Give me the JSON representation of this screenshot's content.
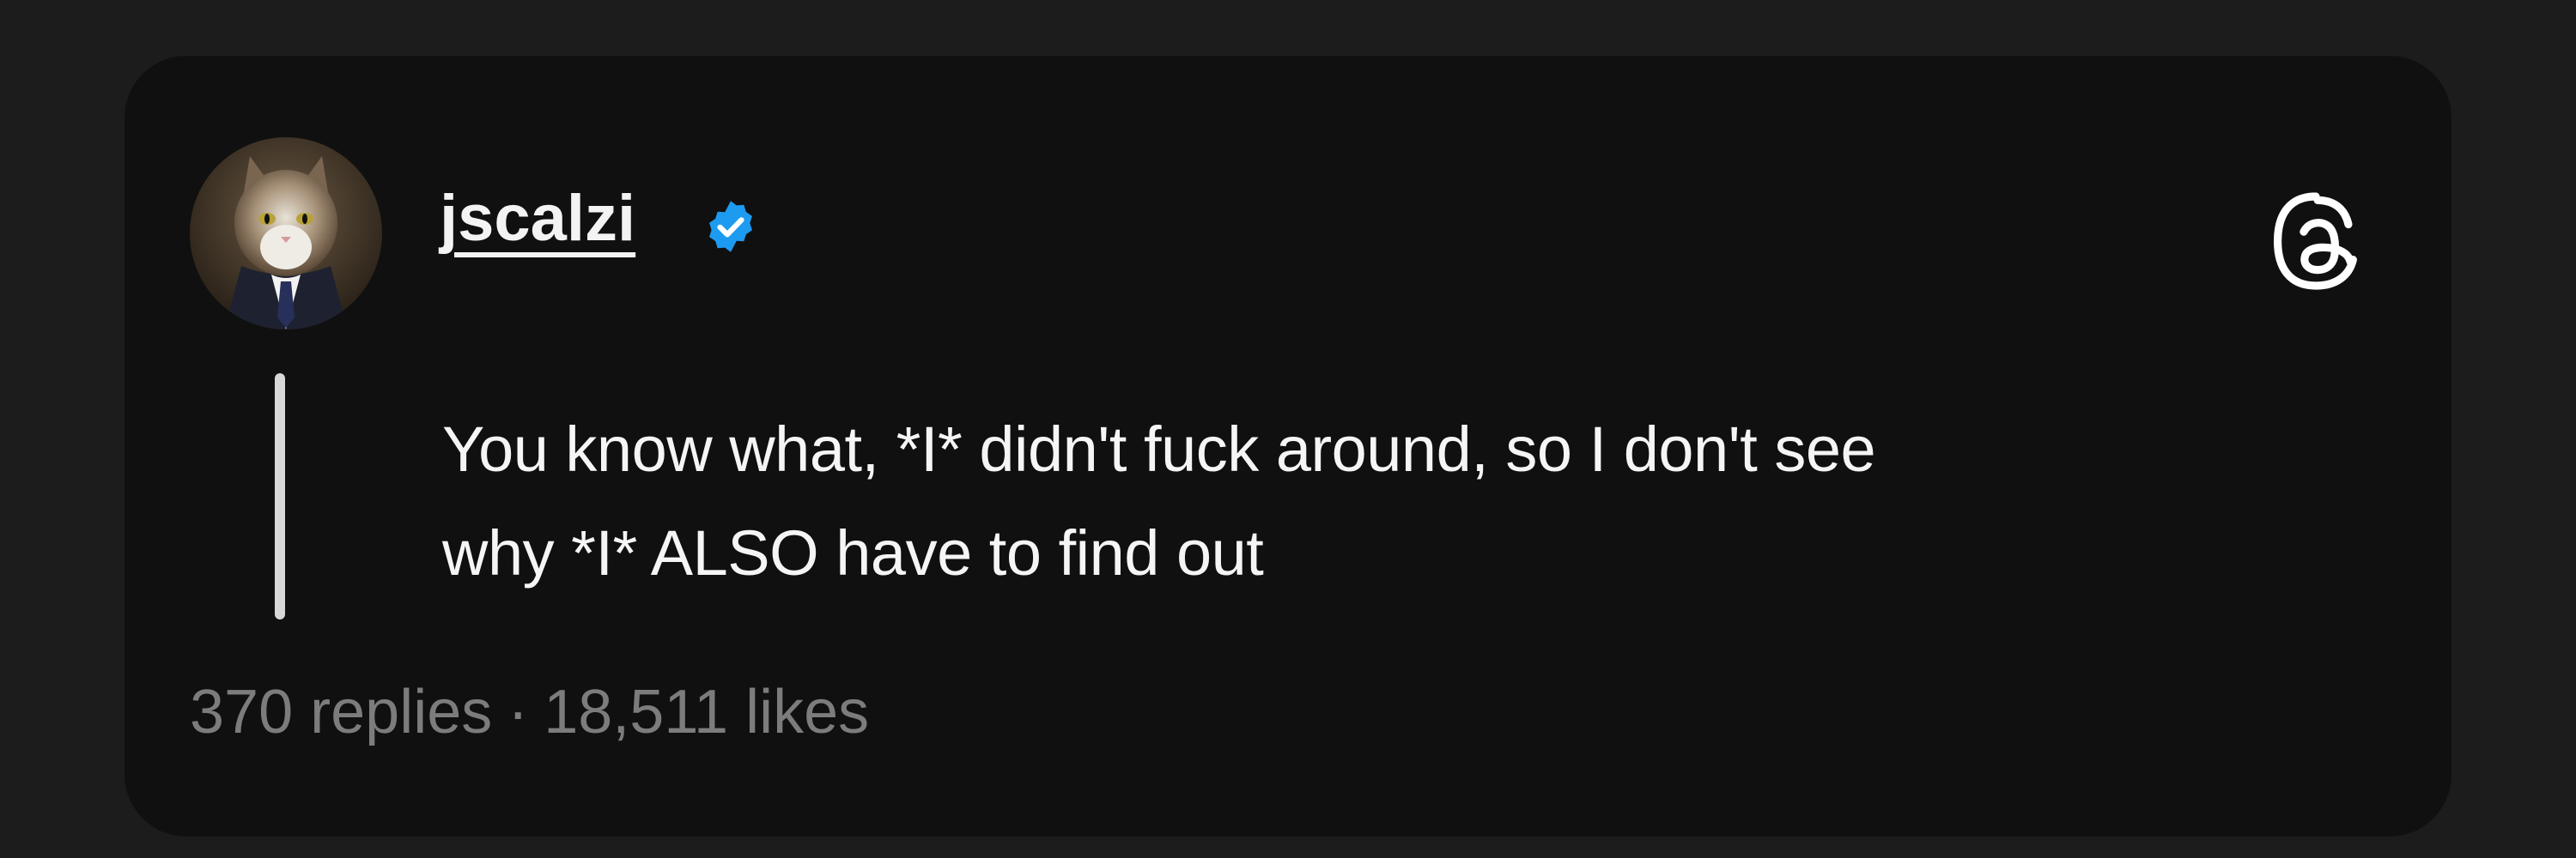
{
  "post": {
    "username": "jscalzi",
    "text_lines": [
      "You know what, *I* didn't fuck around, so I don't see",
      "why *I* ALSO have to find out"
    ],
    "replies": "370 replies",
    "separator": "·",
    "likes": "18,511 likes"
  },
  "icons": {
    "verified": "verified-badge-icon",
    "app": "threads-logo-icon"
  },
  "colors": {
    "page_background": "#1c1c1c",
    "card_background": "#101010",
    "text_primary": "#f5f5f5",
    "text_secondary": "#7c7c7c",
    "verified_blue": "#1d9bf0"
  }
}
